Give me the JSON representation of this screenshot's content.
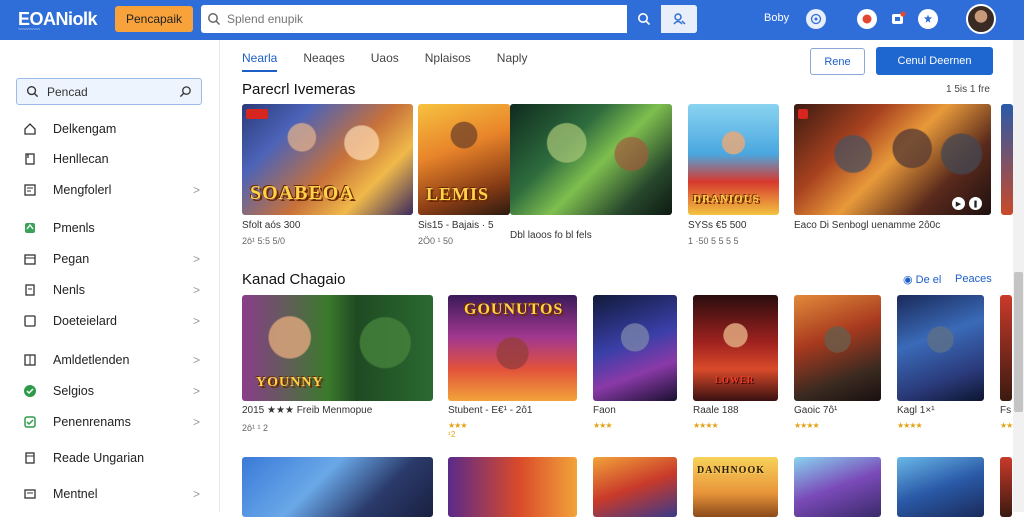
{
  "header": {
    "logo": "EOANiolk",
    "logo_tagline": "~~~~~~~~~",
    "primary_button": "Pencapaik",
    "search_placeholder": "Splend enupik",
    "user_link": "Boby",
    "accent_color": "#2f6ed8",
    "button_color": "#f7a23a"
  },
  "sidebar": {
    "search_value": "Pencad",
    "items": [
      {
        "label": "Delkengam",
        "icon": "home-icon"
      },
      {
        "label": "Henllecan",
        "icon": "bookmark-icon"
      },
      {
        "label": "Mengfolerl",
        "icon": "list-icon",
        "chevron": ">"
      },
      {
        "label": "Pmenls",
        "icon": "tag-icon"
      },
      {
        "label": "Pegan",
        "icon": "calendar-icon",
        "chevron": ">"
      },
      {
        "label": "Nenls",
        "icon": "document-icon",
        "chevron": ">"
      },
      {
        "label": "Doeteielard",
        "icon": "square-icon",
        "chevron": ">"
      },
      {
        "label": "Amldetlenden",
        "icon": "grid-icon",
        "chevron": ">"
      },
      {
        "label": "Selgios",
        "icon": "check-circle-icon",
        "chevron": ">"
      },
      {
        "label": "Penenrenams",
        "icon": "shield-icon",
        "chevron": ">"
      },
      {
        "label": "Reade Ungarian",
        "icon": "book-icon"
      },
      {
        "label": "Mentnel",
        "icon": "monitor-icon",
        "chevron": ">"
      }
    ]
  },
  "tabs": [
    "Nearla",
    "Neaqes",
    "Uaos",
    "Nplaisos",
    "Naply"
  ],
  "actions": {
    "outline_button": "Rene",
    "primary_button": "Cenul Deernen"
  },
  "section1": {
    "title": "Parecrl Ivemeras",
    "meta": "1 5is 1 fre",
    "cards": [
      {
        "caption": "SOABEOA",
        "line1": "Sfolt  aós  300",
        "line2": "2ô¹ 5:5 5/0"
      },
      {
        "caption": "LEMIS",
        "line1": "Sis15 - Bajais · 5",
        "line2": "2Ö0 ¹ 50"
      },
      {
        "caption": "",
        "line1": "Dbl laoos  fo bl fels",
        "line2": ""
      },
      {
        "caption": "DRANIOUS",
        "line1": "SYSs  €5  500",
        "line2": "1 ·50  5 5 5 5"
      },
      {
        "caption": "",
        "line1": "Eaco  Di  Senbogl uenamme  2ô0c",
        "line2": ""
      },
      {
        "caption": "",
        "line1": "",
        "line2": ""
      }
    ]
  },
  "section2": {
    "title": "Kanad Chagaio",
    "view_all": "De el",
    "more": "Peaces",
    "cards": [
      {
        "caption": "YOUNNY",
        "line1": "2015 ★★★ Freib  Menmopue",
        "line2": "2ô¹ ¹ 2"
      },
      {
        "caption": "GOUNUTOS",
        "line1": "Stubent - E€¹ - 2ô1",
        "line2": "★★★ ¹ 2"
      },
      {
        "caption": "",
        "line1": "Faon",
        "line2": "★★★"
      },
      {
        "caption": "LOWER",
        "line1": "Raale 188",
        "line2": "★★★★"
      },
      {
        "caption": "",
        "line1": "Gaoic 7ô¹",
        "line2": "★★★★"
      },
      {
        "caption": "",
        "line1": "Kagl 1×¹",
        "line2": "★★★★"
      },
      {
        "caption": "",
        "line1": "Fs",
        "line2": "★★★"
      }
    ]
  },
  "section3": {
    "cards": [
      {
        "caption": ""
      },
      {
        "caption": ""
      },
      {
        "caption": ""
      },
      {
        "caption": "DANHNOOK"
      },
      {
        "caption": ""
      },
      {
        "caption": ""
      },
      {
        "caption": ""
      }
    ]
  }
}
